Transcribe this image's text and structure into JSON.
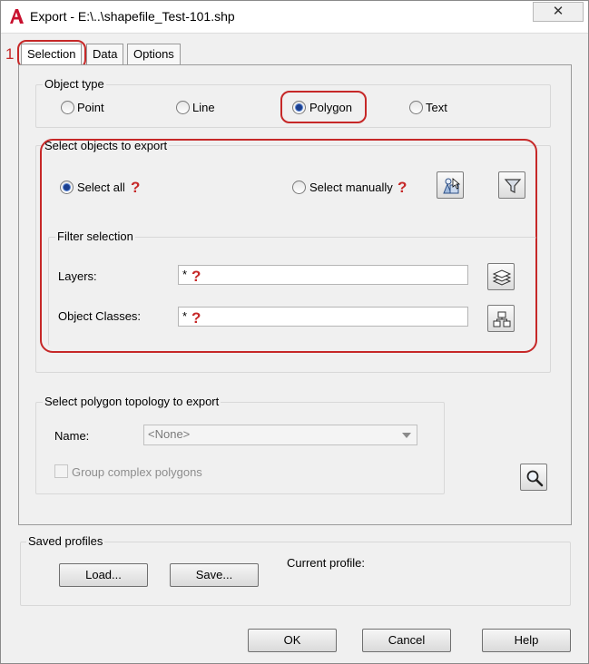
{
  "window": {
    "title": "Export - E:\\..\\shapefile_Test-101.shp",
    "close_glyph": "✕"
  },
  "annotation": {
    "step_number": "1",
    "question_mark": "?"
  },
  "tabs": [
    {
      "label": "Selection",
      "active": true
    },
    {
      "label": "Data",
      "active": false
    },
    {
      "label": "Options",
      "active": false
    }
  ],
  "object_type": {
    "group_label": "Object type",
    "options": [
      {
        "label": "Point",
        "checked": false
      },
      {
        "label": "Line",
        "checked": false
      },
      {
        "label": "Polygon",
        "checked": true
      },
      {
        "label": "Text",
        "checked": false
      }
    ]
  },
  "select_objects": {
    "group_label": "Select objects to export",
    "select_all_label": "Select all",
    "select_manually_label": "Select manually",
    "select_all_checked": true,
    "select_manually_checked": false,
    "filter": {
      "group_label": "Filter selection",
      "layers_label": "Layers:",
      "layers_value": "*",
      "object_classes_label": "Object Classes:",
      "object_classes_value": "*"
    }
  },
  "topology": {
    "group_label": "Select polygon topology to export",
    "name_label": "Name:",
    "name_value": "<None>",
    "group_complex_label": "Group complex polygons",
    "group_complex_checked": false
  },
  "saved_profiles": {
    "group_label": "Saved profiles",
    "load_label": "Load...",
    "save_label": "Save...",
    "current_profile_label": "Current profile:"
  },
  "footer": {
    "ok_label": "OK",
    "cancel_label": "Cancel",
    "help_label": "Help"
  },
  "colors": {
    "annotation_red": "#c62828",
    "radio_fill": "#1b3f8e"
  }
}
